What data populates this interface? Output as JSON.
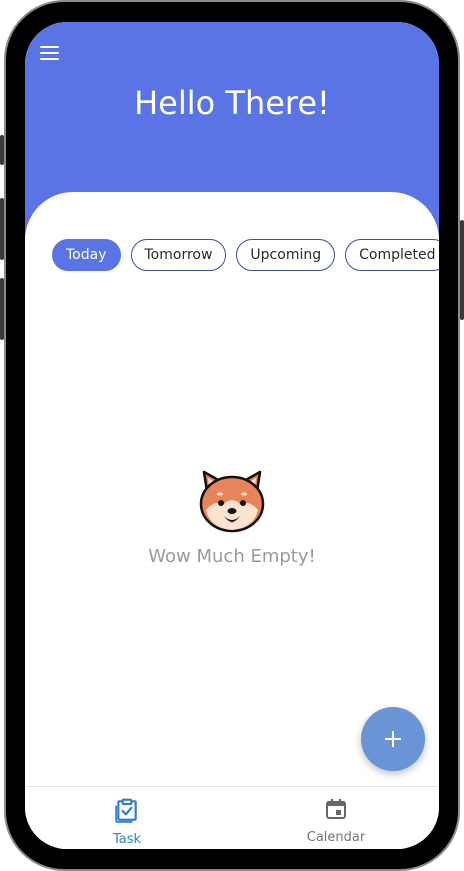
{
  "header": {
    "title": "Hello There!",
    "menu_icon": "menu-icon",
    "background_color": "#5a74e6"
  },
  "tabs": [
    {
      "label": "Today",
      "active": true
    },
    {
      "label": "Tomorrow",
      "active": false
    },
    {
      "label": "Upcoming",
      "active": false
    },
    {
      "label": "Completed",
      "active": false
    }
  ],
  "empty_state": {
    "icon": "shiba-dog-icon",
    "message": "Wow Much Empty!"
  },
  "fab": {
    "icon": "plus-icon",
    "color": "#6a94d6"
  },
  "bottom_nav": {
    "items": [
      {
        "label": "Task",
        "icon": "clipboard-check-icon",
        "active": true,
        "color": "#2a7fd4"
      },
      {
        "label": "Calendar",
        "icon": "calendar-icon",
        "active": false,
        "color": "#777777"
      }
    ]
  }
}
